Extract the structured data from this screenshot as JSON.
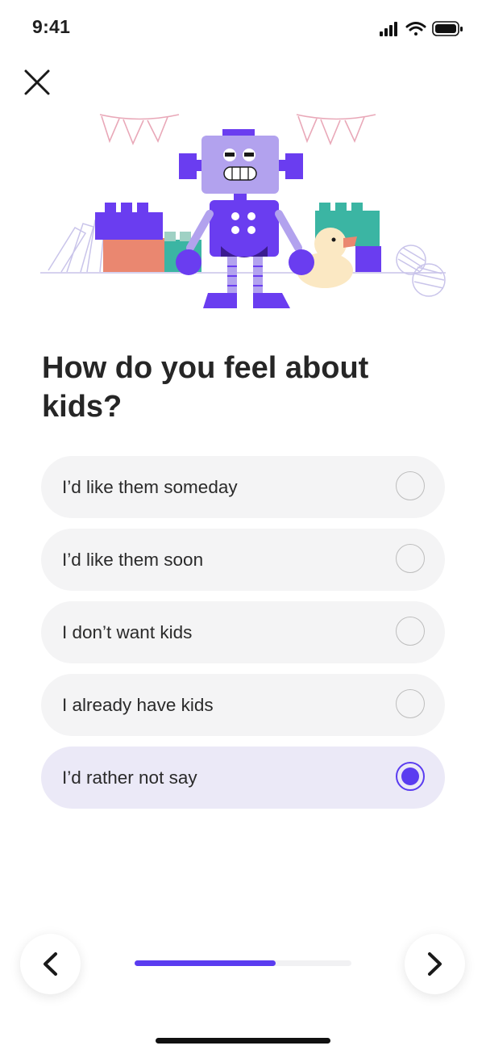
{
  "status_bar": {
    "time": "9:41"
  },
  "question": {
    "title": "How do you feel about kids?"
  },
  "options": [
    {
      "label": "I’d like them someday",
      "selected": false
    },
    {
      "label": "I’d like them soon",
      "selected": false
    },
    {
      "label": "I don’t want kids",
      "selected": false
    },
    {
      "label": "I already have kids",
      "selected": false
    },
    {
      "label": "I’d rather not say",
      "selected": true
    }
  ],
  "progress": {
    "fraction": 0.65
  },
  "colors": {
    "accent": "#5a3cf0",
    "option_bg": "#f4f4f5",
    "option_selected_bg": "#ebe9f7",
    "robot_purple": "#6a3df0",
    "robot_lavender": "#b2a2ee"
  },
  "icons": {
    "close": "close-icon",
    "prev": "chevron-left-icon",
    "next": "chevron-right-icon"
  }
}
